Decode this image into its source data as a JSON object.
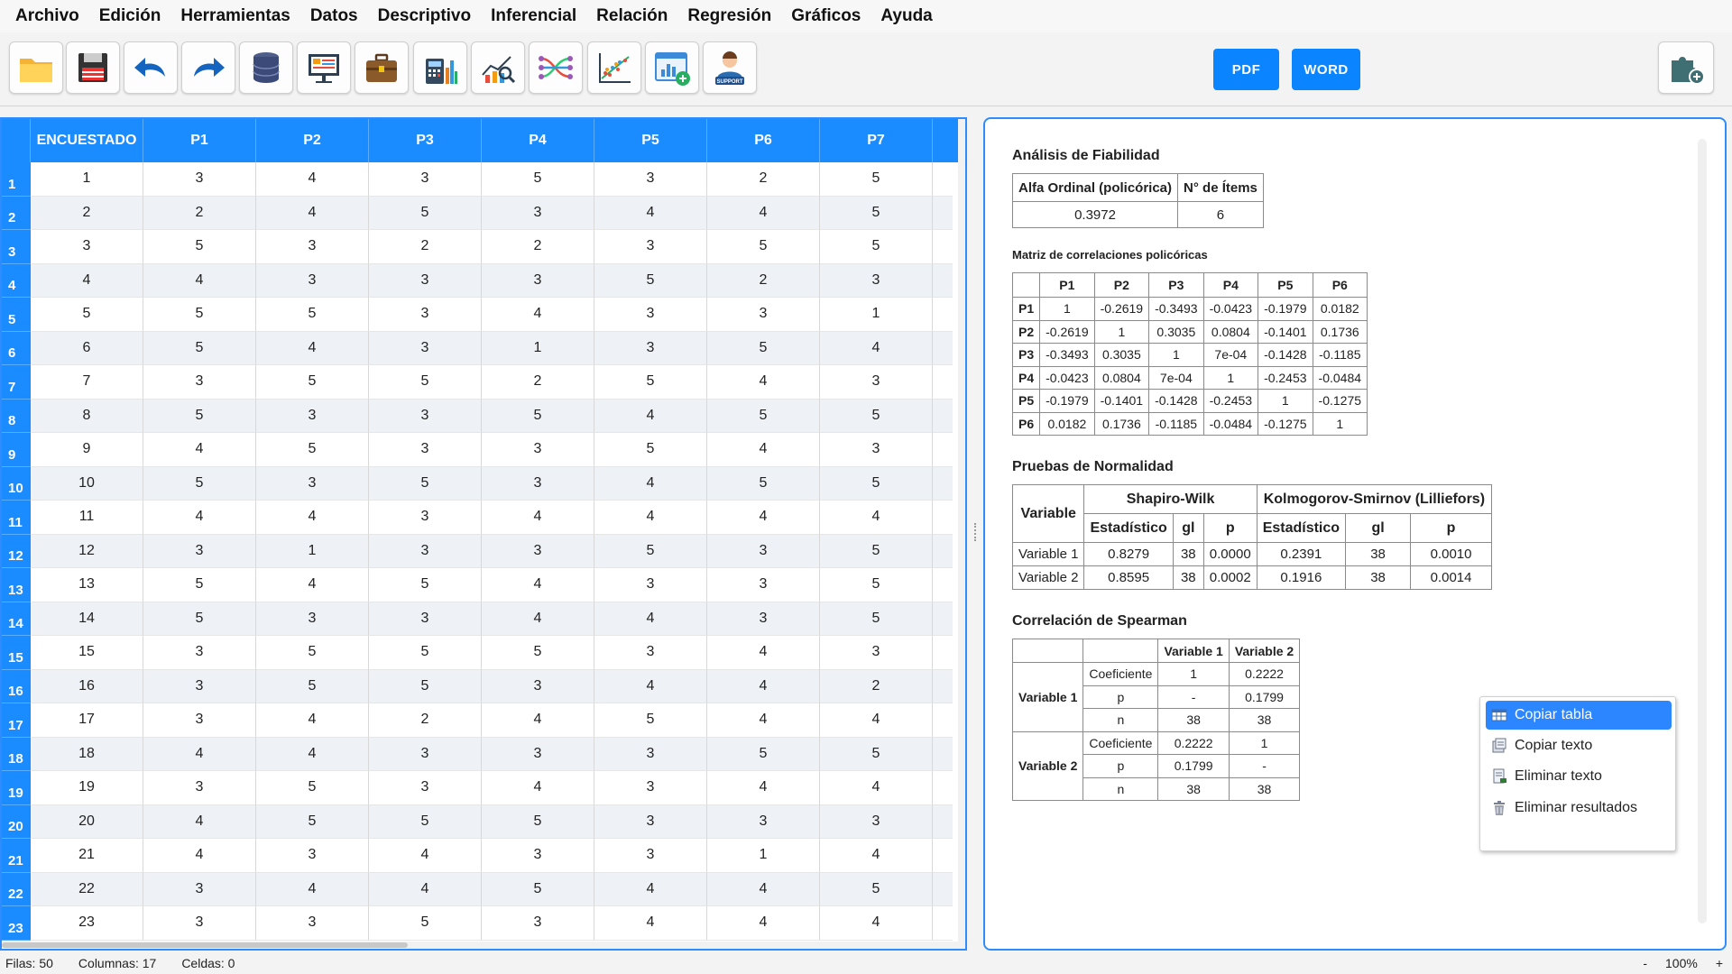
{
  "menu": [
    "Archivo",
    "Edición",
    "Herramientas",
    "Datos",
    "Descriptivo",
    "Inferencial",
    "Relación",
    "Regresión",
    "Gráficos",
    "Ayuda"
  ],
  "toolbar": {
    "icons": [
      "folder-icon",
      "save-icon",
      "undo-icon",
      "redo-icon",
      "database-icon",
      "presentation-icon",
      "briefcase-icon",
      "calculator-icon",
      "chart-analysis-icon",
      "network-icon",
      "scatter-chart-icon",
      "add-chart-icon",
      "support-icon"
    ],
    "support_label": "SUPPORT",
    "pdf_label": "PDF",
    "word_label": "WORD",
    "plugin_icon": "puzzle-plus-icon"
  },
  "grid": {
    "columns": [
      "ENCUESTADO",
      "P1",
      "P2",
      "P3",
      "P4",
      "P5",
      "P6",
      "P7"
    ],
    "rows": [
      [
        "1",
        "3",
        "4",
        "3",
        "5",
        "3",
        "2",
        "5"
      ],
      [
        "2",
        "2",
        "4",
        "5",
        "3",
        "4",
        "4",
        "5"
      ],
      [
        "3",
        "5",
        "3",
        "2",
        "2",
        "3",
        "5",
        "5"
      ],
      [
        "4",
        "4",
        "3",
        "3",
        "3",
        "5",
        "2",
        "3"
      ],
      [
        "5",
        "5",
        "5",
        "3",
        "4",
        "3",
        "3",
        "1"
      ],
      [
        "6",
        "5",
        "4",
        "3",
        "1",
        "3",
        "5",
        "4"
      ],
      [
        "7",
        "3",
        "5",
        "5",
        "2",
        "5",
        "4",
        "3"
      ],
      [
        "8",
        "5",
        "3",
        "3",
        "5",
        "4",
        "5",
        "5"
      ],
      [
        "9",
        "4",
        "5",
        "3",
        "3",
        "5",
        "4",
        "3"
      ],
      [
        "10",
        "5",
        "3",
        "5",
        "3",
        "4",
        "5",
        "5"
      ],
      [
        "11",
        "4",
        "4",
        "3",
        "4",
        "4",
        "4",
        "4"
      ],
      [
        "12",
        "3",
        "1",
        "3",
        "3",
        "5",
        "3",
        "5"
      ],
      [
        "13",
        "5",
        "4",
        "5",
        "4",
        "3",
        "3",
        "5"
      ],
      [
        "14",
        "5",
        "3",
        "3",
        "4",
        "4",
        "3",
        "5"
      ],
      [
        "15",
        "3",
        "5",
        "5",
        "5",
        "3",
        "4",
        "3"
      ],
      [
        "16",
        "3",
        "5",
        "5",
        "3",
        "4",
        "4",
        "2"
      ],
      [
        "17",
        "3",
        "4",
        "2",
        "4",
        "5",
        "4",
        "4"
      ],
      [
        "18",
        "4",
        "4",
        "3",
        "3",
        "3",
        "5",
        "5"
      ],
      [
        "19",
        "3",
        "5",
        "3",
        "4",
        "3",
        "4",
        "4"
      ],
      [
        "20",
        "4",
        "5",
        "5",
        "5",
        "3",
        "3",
        "3"
      ],
      [
        "21",
        "4",
        "3",
        "4",
        "3",
        "3",
        "1",
        "4"
      ],
      [
        "22",
        "3",
        "4",
        "4",
        "5",
        "4",
        "4",
        "5"
      ],
      [
        "23",
        "3",
        "3",
        "5",
        "3",
        "4",
        "4",
        "4"
      ]
    ]
  },
  "results": {
    "reliability": {
      "title": "Análisis de Fiabilidad",
      "headers": [
        "Alfa Ordinal (policórica)",
        "N° de Ítems"
      ],
      "values": [
        "0.3972",
        "6"
      ]
    },
    "polychoric": {
      "title": "Matriz de correlaciones policóricas",
      "labels": [
        "P1",
        "P2",
        "P3",
        "P4",
        "P5",
        "P6"
      ],
      "matrix": [
        [
          "1",
          "-0.2619",
          "-0.3493",
          "-0.0423",
          "-0.1979",
          "0.0182"
        ],
        [
          "-0.2619",
          "1",
          "0.3035",
          "0.0804",
          "-0.1401",
          "0.1736"
        ],
        [
          "-0.3493",
          "0.3035",
          "1",
          "7e-04",
          "-0.1428",
          "-0.1185"
        ],
        [
          "-0.0423",
          "0.0804",
          "7e-04",
          "1",
          "-0.2453",
          "-0.0484"
        ],
        [
          "-0.1979",
          "-0.1401",
          "-0.1428",
          "-0.2453",
          "1",
          "-0.1275"
        ],
        [
          "0.0182",
          "0.1736",
          "-0.1185",
          "-0.0484",
          "-0.1275",
          "1"
        ]
      ]
    },
    "normality": {
      "title": "Pruebas de Normalidad",
      "variable_label": "Variable",
      "group1": "Shapiro-Wilk",
      "group2": "Kolmogorov-Smirnov (Lilliefors)",
      "subheaders": [
        "Estadístico",
        "gl",
        "p",
        "Estadístico",
        "gl",
        "p"
      ],
      "rows": [
        [
          "Variable 1",
          "0.8279",
          "38",
          "0.0000",
          "0.2391",
          "38",
          "0.0010"
        ],
        [
          "Variable 2",
          "0.8595",
          "38",
          "0.0002",
          "0.1916",
          "38",
          "0.0014"
        ]
      ]
    },
    "spearman": {
      "title": "Correlación de Spearman",
      "col_headers": [
        "Variable 1",
        "Variable 2"
      ],
      "groups": [
        {
          "name": "Variable 1",
          "rows": [
            [
              "Coeficiente",
              "1",
              "0.2222"
            ],
            [
              "p",
              "-",
              "0.1799"
            ],
            [
              "n",
              "38",
              "38"
            ]
          ]
        },
        {
          "name": "Variable 2",
          "rows": [
            [
              "Coeficiente",
              "0.2222",
              "1"
            ],
            [
              "p",
              "0.1799",
              "-"
            ],
            [
              "n",
              "38",
              "38"
            ]
          ]
        }
      ]
    }
  },
  "context_menu": {
    "items": [
      {
        "label": "Copiar tabla",
        "icon": "table-icon",
        "active": true
      },
      {
        "label": "Copiar texto",
        "icon": "copy-text-icon",
        "active": false
      },
      {
        "label": "Eliminar texto",
        "icon": "delete-text-icon",
        "active": false
      },
      {
        "label": "Eliminar resultados",
        "icon": "trash-icon",
        "active": false
      }
    ]
  },
  "status": {
    "rows": "Filas: 50",
    "columns": "Columnas: 17",
    "cells": "Celdas: 0",
    "zoom_minus": "-",
    "zoom": "100%",
    "zoom_plus": "+"
  }
}
